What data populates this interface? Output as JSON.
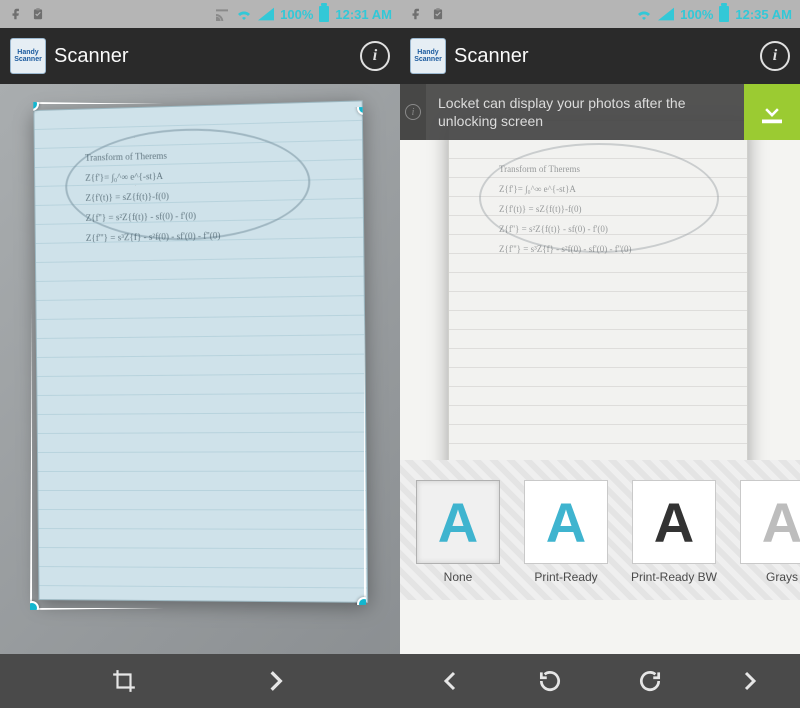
{
  "left": {
    "statusbar": {
      "battery_pct": "100%",
      "clock": "12:31 AM"
    },
    "actionbar": {
      "app_icon_line1": "Handy",
      "app_icon_line2": "Scanner",
      "title": "Scanner",
      "info_glyph": "i"
    },
    "document_text": "Transform of Therems\nZ{f'}= ∫₀^∞ e^{-st}A\nZ{f'(t)} = sZ{f(t)}-f(0)\nZ{f''} = s²Z{f(t)} - sf(0) - f'(0)\nZ{f'''} = s³Z{f} - s²f(0) - sf'(0) - f''(0)",
    "bottombar": {
      "crop_icon": "crop-icon",
      "next_icon": "chevron-right-icon"
    }
  },
  "right": {
    "statusbar": {
      "battery_pct": "100%",
      "clock": "12:35 AM"
    },
    "actionbar": {
      "app_icon_line1": "Handy",
      "app_icon_line2": "Scanner",
      "title": "Scanner",
      "info_glyph": "i"
    },
    "notification": {
      "text": "Locket can display your photos after the unlocking screen"
    },
    "document_text": "Transform of Therems\nZ{f'}= ∫₀^∞ e^{-st}A\nZ{f'(t)} = sZ{f(t)}-f(0)\nZ{f''} = s²Z{f(t)} - sf(0) - f'(0)\nZ{f'''} = s³Z{f} - s²f(0) - sf'(0) - f''(0)",
    "filters": [
      {
        "label": "None",
        "swatch_letter": "A",
        "swatch_class": "swatch-none",
        "selected": true
      },
      {
        "label": "Print-Ready",
        "swatch_letter": "A",
        "swatch_class": "swatch-pr",
        "selected": false
      },
      {
        "label": "Print-Ready BW",
        "swatch_letter": "A",
        "swatch_class": "swatch-bw",
        "selected": false
      },
      {
        "label": "Grays",
        "swatch_letter": "A",
        "swatch_class": "swatch-gr",
        "selected": false
      }
    ],
    "bottombar": {
      "back_icon": "chevron-left-icon",
      "rotate_ccw_icon": "rotate-ccw-icon",
      "rotate_cw_icon": "rotate-cw-icon",
      "next_icon": "chevron-right-icon"
    }
  }
}
